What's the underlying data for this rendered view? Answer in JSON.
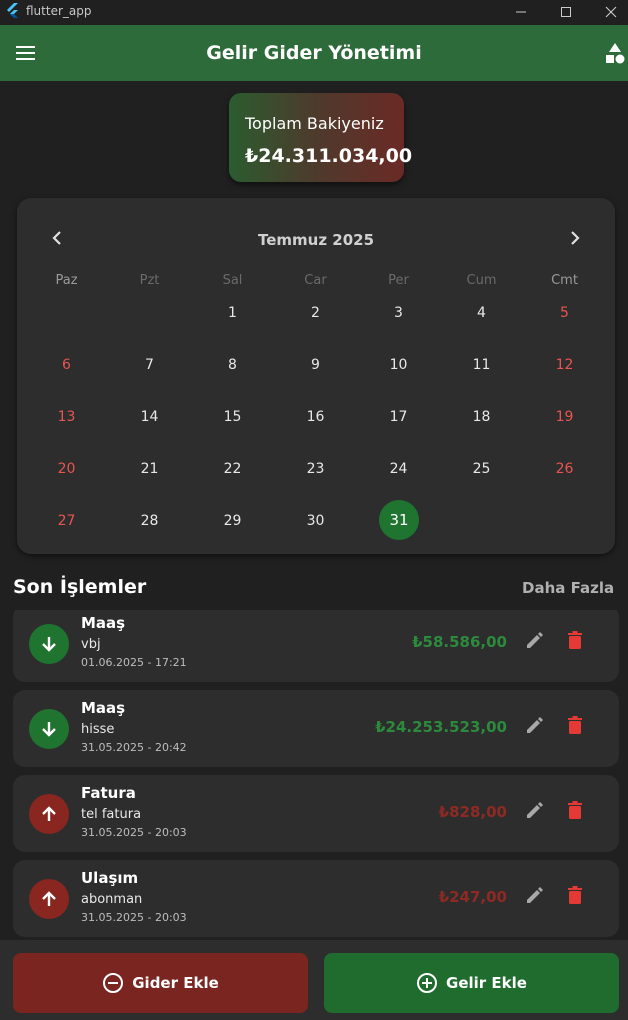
{
  "window": {
    "title": "flutter_app"
  },
  "appbar": {
    "title": "Gelir Gider Yönetimi"
  },
  "balance": {
    "label": "Toplam Bakiyeniz",
    "amount": "₺24.311.034,00"
  },
  "calendar": {
    "month": "Temmuz 2025",
    "weekdays": [
      "Paz",
      "Pzt",
      "Sal",
      "Car",
      "Per",
      "Cum",
      "Cmt"
    ],
    "days": [
      "1",
      "2",
      "3",
      "4",
      "5",
      "6",
      "7",
      "8",
      "9",
      "10",
      "11",
      "12",
      "13",
      "14",
      "15",
      "16",
      "17",
      "18",
      "19",
      "20",
      "21",
      "22",
      "23",
      "24",
      "25",
      "26",
      "27",
      "28",
      "29",
      "30",
      "31"
    ],
    "selected_day": "31"
  },
  "recent": {
    "title": "Son İşlemler",
    "more_label": "Daha Fazla"
  },
  "transactions": [
    {
      "title": "Maaş",
      "description": "vbj",
      "date": "01.06.2025 - 17:21",
      "amount": "₺58.586,00",
      "type": "income"
    },
    {
      "title": "Maaş",
      "description": "hisse",
      "date": "31.05.2025 - 20:42",
      "amount": "₺24.253.523,00",
      "type": "income"
    },
    {
      "title": "Fatura",
      "description": "tel fatura",
      "date": "31.05.2025 - 20:03",
      "amount": "₺828,00",
      "type": "expense"
    },
    {
      "title": "Ulaşım",
      "description": "abonman",
      "date": "31.05.2025 - 20:03",
      "amount": "₺247,00",
      "type": "expense"
    }
  ],
  "actions": {
    "expense_label": "Gider Ekle",
    "income_label": "Gelir Ekle"
  },
  "colors": {
    "appbar": "#2e6b3a",
    "income": "#1f7530",
    "expense": "#8a2620",
    "weekend": "#e85550"
  }
}
